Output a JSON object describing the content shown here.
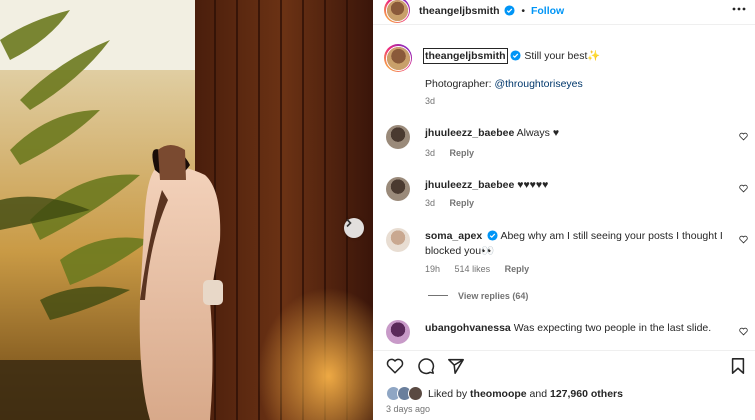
{
  "post": {
    "username": "theangeljbsmith",
    "follow_label": "Follow",
    "separator": "•",
    "caption": {
      "text": "Still your best",
      "sparkle": "✨",
      "photographer_label": "Photographer:",
      "photographer_handle": "@throughtoriseyes",
      "time": "3d"
    }
  },
  "comments": [
    {
      "username": "jhuuleezz_baebee",
      "text": "Always",
      "emoji": "♥",
      "time": "3d",
      "likes": "",
      "reply_label": "Reply"
    },
    {
      "username": "jhuuleezz_baebee",
      "text": "",
      "emoji": "♥♥♥♥♥",
      "time": "3d",
      "likes": "",
      "reply_label": "Reply"
    },
    {
      "username": "soma_apex",
      "verified": true,
      "text_line1": "Abeg why am I still seeing your posts I thought I",
      "text_line2": "blocked you",
      "emoji": "👀",
      "time": "19h",
      "likes": "514 likes",
      "reply_label": "Reply",
      "view_replies": "View replies (64)"
    },
    {
      "username": "ubangohvanessa",
      "text": "Was expecting two people in the last slide."
    }
  ],
  "likes": {
    "prefix": "Liked by",
    "first_user": "theomoope",
    "connector": "and",
    "count": "127,960 others"
  },
  "posted_ago": "3 days ago",
  "colors": {
    "accent": "#0095f6",
    "link": "#00376b",
    "muted": "#737373"
  },
  "icons": [
    "more-options-icon",
    "heart-icon",
    "comment-icon",
    "share-icon",
    "bookmark-icon",
    "verified-icon",
    "chevron-right-icon"
  ]
}
